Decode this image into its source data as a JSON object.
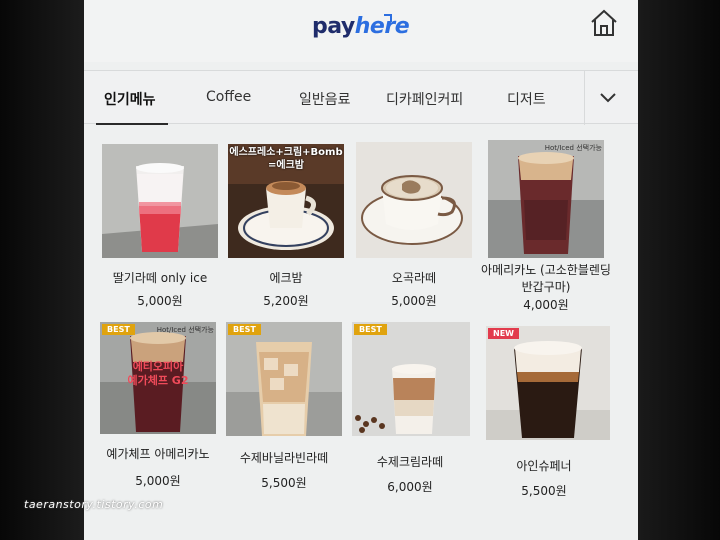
{
  "header": {
    "logo_pay": "pay",
    "logo_here": "here",
    "home_icon": "home-icon"
  },
  "tabs": [
    {
      "label": "인기메뉴",
      "active": true
    },
    {
      "label": "Coffee"
    },
    {
      "label": "일반음료"
    },
    {
      "label": "디카페인커피"
    },
    {
      "label": "디저트"
    }
  ],
  "more_icon": "chevron-down-icon",
  "products": [
    {
      "name": "딸기라떼 only ice",
      "price": "5,000원"
    },
    {
      "name": "에크밤",
      "price": "5,200원",
      "overlay": "에스프레소+크림+Bomb\n=에크밤"
    },
    {
      "name": "오곡라떼",
      "price": "5,000원"
    },
    {
      "name": "아메리카노 (고소한블렌딩 반갑구마)",
      "price": "4,000원",
      "hot_tag": "Hot/Iced 선택가능"
    },
    {
      "name": "예가체프 아메리카노",
      "price": "5,000원",
      "badge": "BEST",
      "hot_tag": "Hot/Iced 선택가능",
      "promo": "에티오피아\n예가체프 G2"
    },
    {
      "name": "수제바닐라빈라떼",
      "price": "5,500원",
      "badge": "BEST"
    },
    {
      "name": "수제크림라떼",
      "price": "6,000원",
      "badge": "BEST"
    },
    {
      "name": "아인슈페너",
      "price": "5,500원",
      "badge": "NEW"
    }
  ],
  "watermark": "taeranstory.tistory.com",
  "colors": {
    "brand_navy": "#1f2c6b",
    "brand_blue": "#2c6ee0",
    "best_badge": "#e0a30e",
    "new_badge": "#e23b4d"
  }
}
